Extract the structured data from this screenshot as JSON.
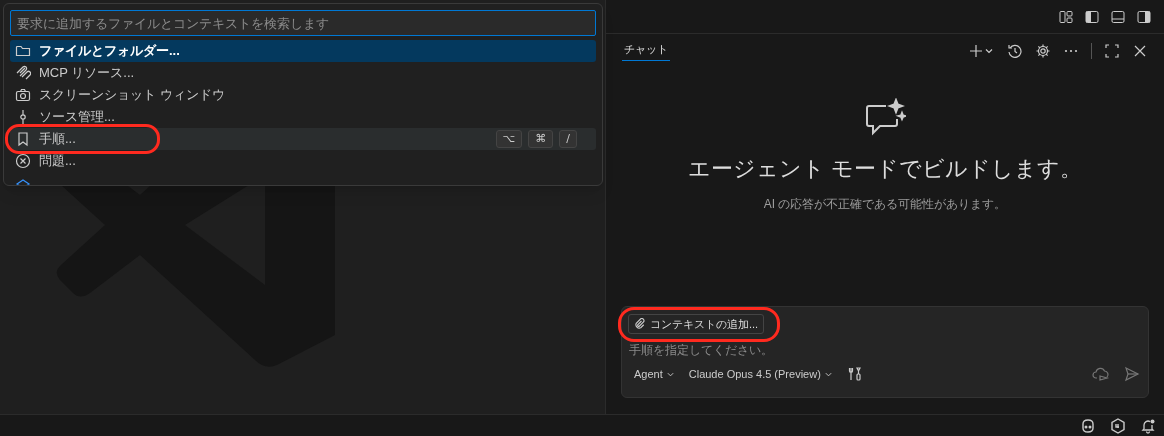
{
  "quick_pick": {
    "placeholder": "要求に追加するファイルとコンテキストを検索します",
    "items": [
      {
        "kind": "folder",
        "label": "ファイルとフォルダー...",
        "selected": true,
        "hovered": false,
        "highlighted": false
      },
      {
        "kind": "mcp",
        "label": "MCP リソース...",
        "selected": false,
        "hovered": false,
        "highlighted": false
      },
      {
        "kind": "camera",
        "label": "スクリーンショット ウィンドウ",
        "selected": false,
        "hovered": false,
        "highlighted": false
      },
      {
        "kind": "git",
        "label": "ソース管理...",
        "selected": false,
        "hovered": false,
        "highlighted": false
      },
      {
        "kind": "bookmark",
        "label": "手順...",
        "selected": false,
        "hovered": true,
        "highlighted": true,
        "keys": [
          "⌥",
          "⌘",
          "/"
        ]
      },
      {
        "kind": "error",
        "label": "問題...",
        "selected": false,
        "hovered": false,
        "highlighted": false
      },
      {
        "kind": "symbol",
        "selected": false,
        "hovered": false
      }
    ]
  },
  "chat": {
    "tabs": [
      {
        "label": "チャット",
        "selected": true
      }
    ],
    "heading": "エージェント モードでビルドします。",
    "disclaimer": "AI の応答が不正確である可能性があります。",
    "input": {
      "attach_button": {
        "label": "コンテキストの追加...",
        "highlighted": true
      },
      "placeholder": "手順を指定してください。",
      "mode": "Agent",
      "model": "Claude Opus 4.5 (Preview)"
    }
  }
}
